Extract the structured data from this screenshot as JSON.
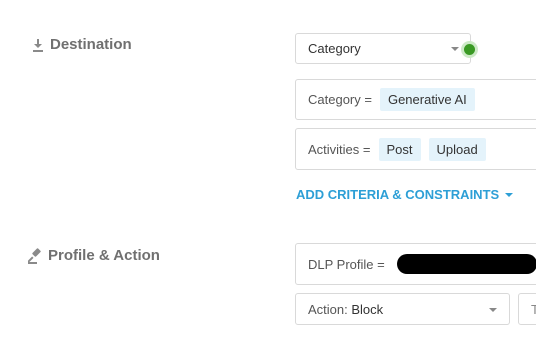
{
  "destination": {
    "label": "Destination",
    "icon": "download-icon",
    "type_select": {
      "value": "Category"
    },
    "status_color": "#3a9a24",
    "criteria": [
      {
        "label": "Category =",
        "values": [
          "Generative AI"
        ]
      },
      {
        "label": "Activities =",
        "values": [
          "Post",
          "Upload"
        ]
      }
    ],
    "add_criteria_label": "ADD CRITERIA & CONSTRAINTS"
  },
  "profile_action": {
    "label": "Profile & Action",
    "icon": "gavel-icon",
    "dlp_profile_label": "DLP Profile =",
    "action_select": {
      "prefix": "Action: ",
      "value": "Block"
    },
    "truncated_field_text": "T"
  },
  "colors": {
    "accent": "#2d9fd6",
    "pill_bg": "#e4f3fb",
    "section_label": "#707070"
  }
}
